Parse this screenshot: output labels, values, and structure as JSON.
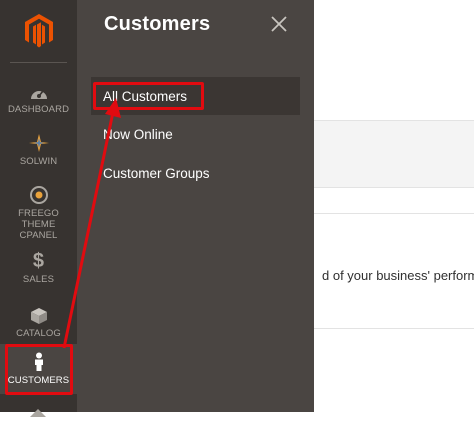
{
  "sidebar": {
    "logo": "magento-logo",
    "items": [
      {
        "label": "DASHBOARD",
        "icon": "dashboard-icon"
      },
      {
        "label": "SOLWIN",
        "icon": "solwin-icon"
      },
      {
        "label": "FREEGO THEME CPANEL",
        "icon": "target-icon"
      },
      {
        "label": "SALES",
        "icon": "dollar-icon"
      },
      {
        "label": "CATALOG",
        "icon": "cube-icon"
      },
      {
        "label": "CUSTOMERS",
        "icon": "person-icon"
      }
    ]
  },
  "flyout": {
    "title": "Customers",
    "close_icon": "close-icon",
    "items": [
      {
        "label": "All Customers"
      },
      {
        "label": "Now Online"
      },
      {
        "label": "Customer Groups"
      }
    ]
  },
  "content": {
    "text": "d of your business' performa"
  },
  "colors": {
    "sidebar_bg": "#373330",
    "flyout_bg": "#4a4542",
    "accent_orange": "#eb5202",
    "annotation_red": "#e10b10"
  }
}
